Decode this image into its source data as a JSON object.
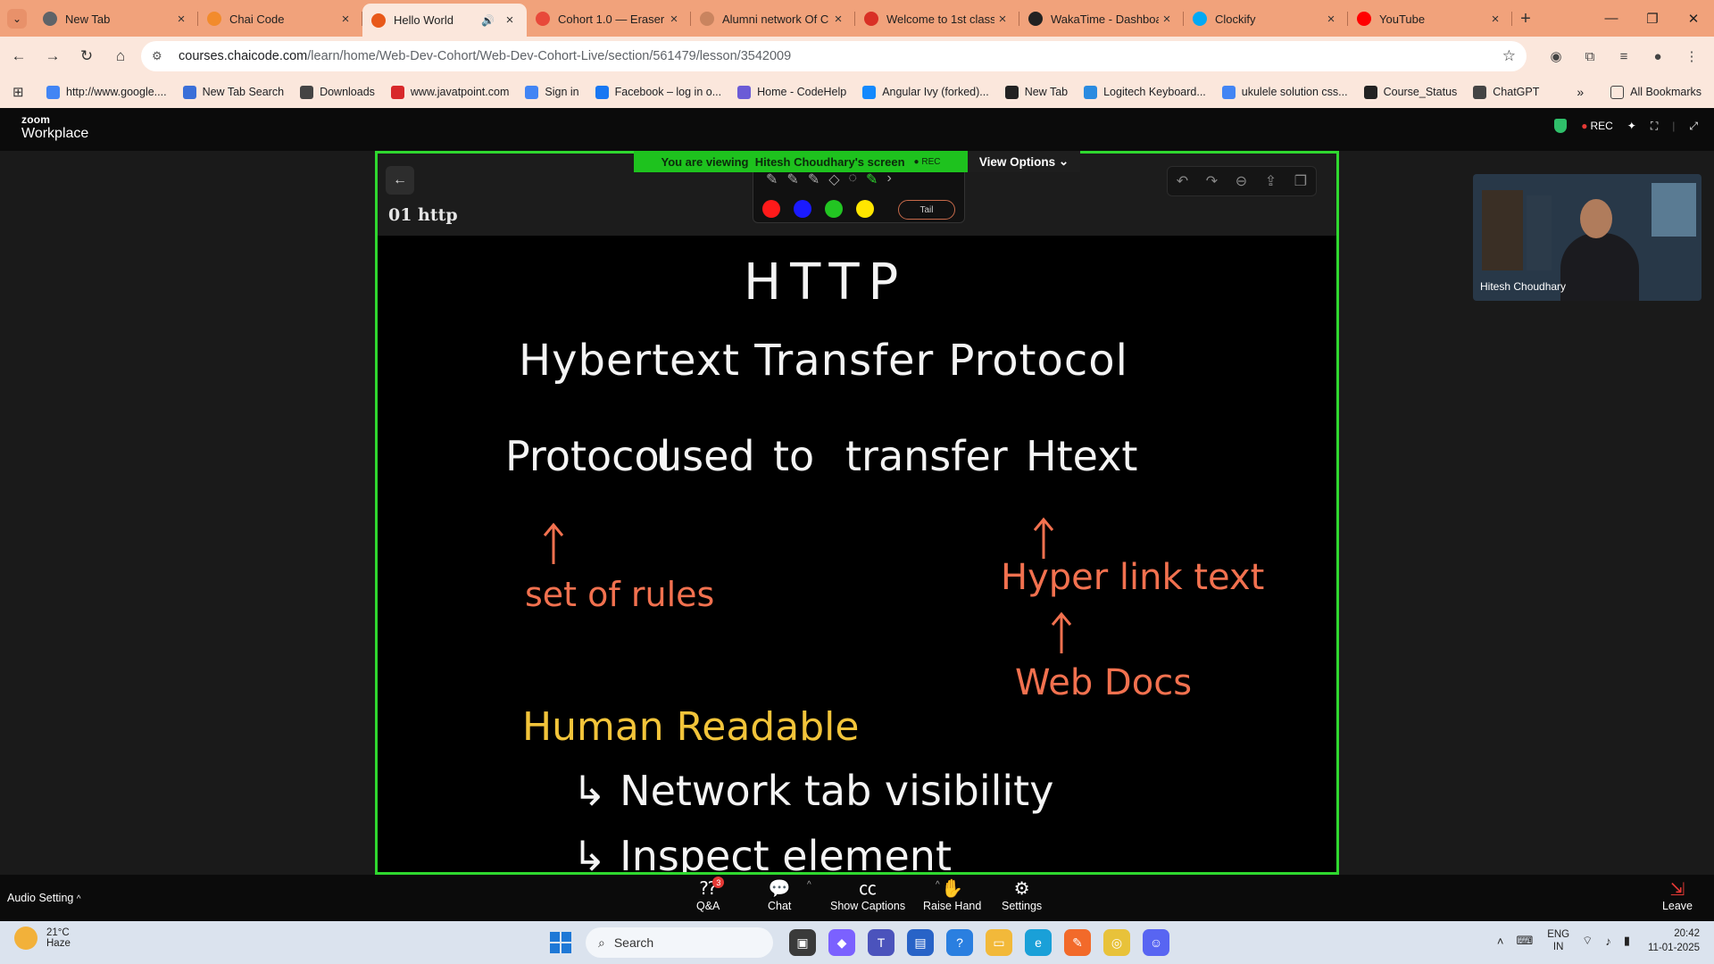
{
  "browser": {
    "tabs": [
      {
        "title": "New Tab",
        "icon": "chrome-icon",
        "color": "#5f6368",
        "active": false
      },
      {
        "title": "Chai Code",
        "icon": "chaicode-icon",
        "color": "#f28b2c",
        "active": false
      },
      {
        "title": "Hello World",
        "icon": "chaicode-icon",
        "color": "#e8591a",
        "active": true
      },
      {
        "title": "Cohort 1.0 — Eraser",
        "icon": "eraser-icon",
        "color": "#e8493a",
        "active": false
      },
      {
        "title": "Alumni network Of C",
        "icon": "page-icon",
        "color": "#c9845f",
        "active": false
      },
      {
        "title": "Welcome to 1st class",
        "icon": "gmail-icon",
        "color": "#d93025",
        "active": false
      },
      {
        "title": "WakaTime - Dashboa",
        "icon": "wakatime-icon",
        "color": "#222222",
        "active": false
      },
      {
        "title": "Clockify",
        "icon": "clockify-icon",
        "color": "#03a9f4",
        "active": false
      },
      {
        "title": "YouTube",
        "icon": "youtube-icon",
        "color": "#ff0000",
        "active": false
      }
    ],
    "url_host": "courses.chaicode.com",
    "url_path": "/learn/home/Web-Dev-Cohort/Web-Dev-Cohort-Live/section/561479/lesson/3542009",
    "bookmarks": [
      {
        "label": "http://www.google....",
        "icon": "google-icon",
        "color": "#4285f4"
      },
      {
        "label": "New Tab Search",
        "icon": "search-bookmark-icon",
        "color": "#3a6fd8"
      },
      {
        "label": "Downloads",
        "icon": "download-icon",
        "color": "#444444"
      },
      {
        "label": "www.javatpoint.com",
        "icon": "javatpoint-icon",
        "color": "#d8282a"
      },
      {
        "label": "Sign in",
        "icon": "google-icon",
        "color": "#4285f4"
      },
      {
        "label": "Facebook – log in o...",
        "icon": "facebook-icon",
        "color": "#1877f2"
      },
      {
        "label": "Home - CodeHelp",
        "icon": "codehelp-icon",
        "color": "#6b5bd6"
      },
      {
        "label": "Angular Ivy (forked)...",
        "icon": "stackblitz-icon",
        "color": "#1389fd"
      },
      {
        "label": "New Tab",
        "icon": "chrome-icon",
        "color": "#222222"
      },
      {
        "label": "Logitech Keyboard...",
        "icon": "w-icon",
        "color": "#2a8be0"
      },
      {
        "label": "ukulele solution css...",
        "icon": "google-icon",
        "color": "#4285f4"
      },
      {
        "label": "Course_Status",
        "icon": "github-icon",
        "color": "#222222"
      },
      {
        "label": "ChatGPT",
        "icon": "chatgpt-icon",
        "color": "#444444"
      }
    ],
    "all_bookmarks": "All Bookmarks"
  },
  "zoom": {
    "brand_top": "zoom",
    "brand_bottom": "Workplace",
    "rec": "REC",
    "viewing_prefix": "You are viewing",
    "viewing_name": "Hitesh Choudhary's screen",
    "view_options": "View Options",
    "participant_name": "Hitesh Choudhary",
    "audio_setting": "Audio Setting",
    "controls": [
      {
        "label": "Q&A",
        "icon": "qa-icon",
        "badge": "3"
      },
      {
        "label": "Chat",
        "icon": "chat-icon"
      },
      {
        "label": "Show Captions",
        "icon": "cc-icon"
      },
      {
        "label": "Raise Hand",
        "icon": "hand-icon"
      },
      {
        "label": "Settings",
        "icon": "gear-icon"
      }
    ],
    "leave": "Leave"
  },
  "whiteboard": {
    "title": "01 http",
    "tail_label": "Tail",
    "swatches": [
      "#ff1a1a",
      "#1a1aff",
      "#22c522",
      "#ffe600"
    ],
    "notes": {
      "heading": "HTTP",
      "expansion": "Hybertext Transfer Protocol",
      "line1_a": "Protocol",
      "line1_b": "used",
      "line1_c": "to",
      "line1_d": "transfer",
      "line1_e": "Htext",
      "rules": "set of rules",
      "hyperlink": "Hyper link text",
      "webdocs": "Web Docs",
      "human_readable": "Human Readable",
      "bullet1": "↳ Network tab visibility",
      "bullet2": "↳ Inspect element"
    },
    "colors": {
      "white": "#f4f4f4",
      "orange": "#f2714f",
      "yellow": "#f2c43a"
    }
  },
  "taskbar": {
    "temp": "21°C",
    "condition": "Haze",
    "search": "Search",
    "lang_top": "ENG",
    "lang_bottom": "IN",
    "time": "20:42",
    "date": "11-01-2025"
  }
}
